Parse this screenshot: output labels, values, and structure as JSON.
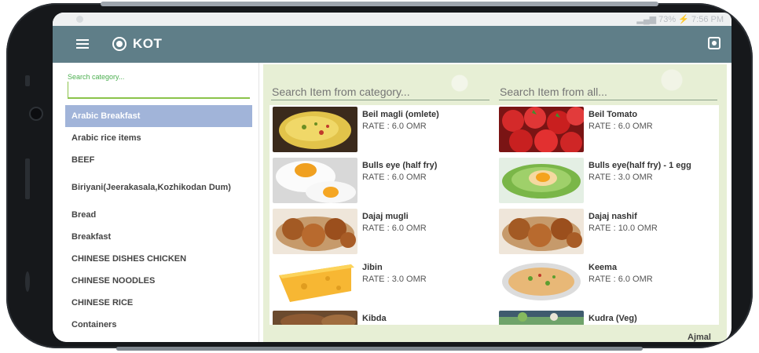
{
  "status_bar": {
    "time": "7:56 PM",
    "battery": "73%"
  },
  "app": {
    "title": "KOT"
  },
  "sidebar": {
    "search_label": "Search category...",
    "search_value": "",
    "categories": [
      "Arabic Breakfast",
      "Arabic rice items",
      "BEEF",
      "Biriyani(Jeerakasala,Kozhikodan Dum)",
      "Bread",
      "Breakfast",
      "CHINESE DISHES CHICKEN",
      "CHINESE NOODLES",
      "CHINESE RICE",
      "Containers"
    ],
    "active_index": 0
  },
  "main": {
    "search_category_placeholder": "Search Item from category...",
    "search_all_placeholder": "Search Item from all...",
    "items": [
      {
        "name": "Beil magli (omlete)",
        "rate": "RATE : 6.0 OMR",
        "image": "omelette-photo"
      },
      {
        "name": "Beil Tomato",
        "rate": "RATE : 6.0 OMR",
        "image": "tomato-photo"
      },
      {
        "name": "Bulls eye (half fry)",
        "rate": "RATE : 6.0 OMR",
        "image": "fried-egg-photo"
      },
      {
        "name": "Bulls eye(half fry) - 1 egg",
        "rate": "RATE : 3.0 OMR",
        "image": "egg-on-greens-photo"
      },
      {
        "name": "Dajaj mugli",
        "rate": "RATE : 6.0 OMR",
        "image": "fried-chicken-photo"
      },
      {
        "name": "Dajaj nashif",
        "rate": "RATE : 10.0 OMR",
        "image": "fried-chicken-photo"
      },
      {
        "name": "Jibin",
        "rate": "RATE : 3.0 OMR",
        "image": "cheese-photo"
      },
      {
        "name": "Keema",
        "rate": "RATE : 6.0 OMR",
        "image": "keema-plate-photo"
      },
      {
        "name": "Kibda",
        "rate": "",
        "image": "kibda-photo"
      },
      {
        "name": "Kudra (Veg)",
        "rate": "",
        "image": "vegetables-photo"
      }
    ],
    "user": "Ajmal"
  },
  "colors": {
    "appbar": "#5f7e88",
    "active_category": "#a1b4d9",
    "content_bg": "#e7efd5",
    "accent": "#8bc34a"
  }
}
